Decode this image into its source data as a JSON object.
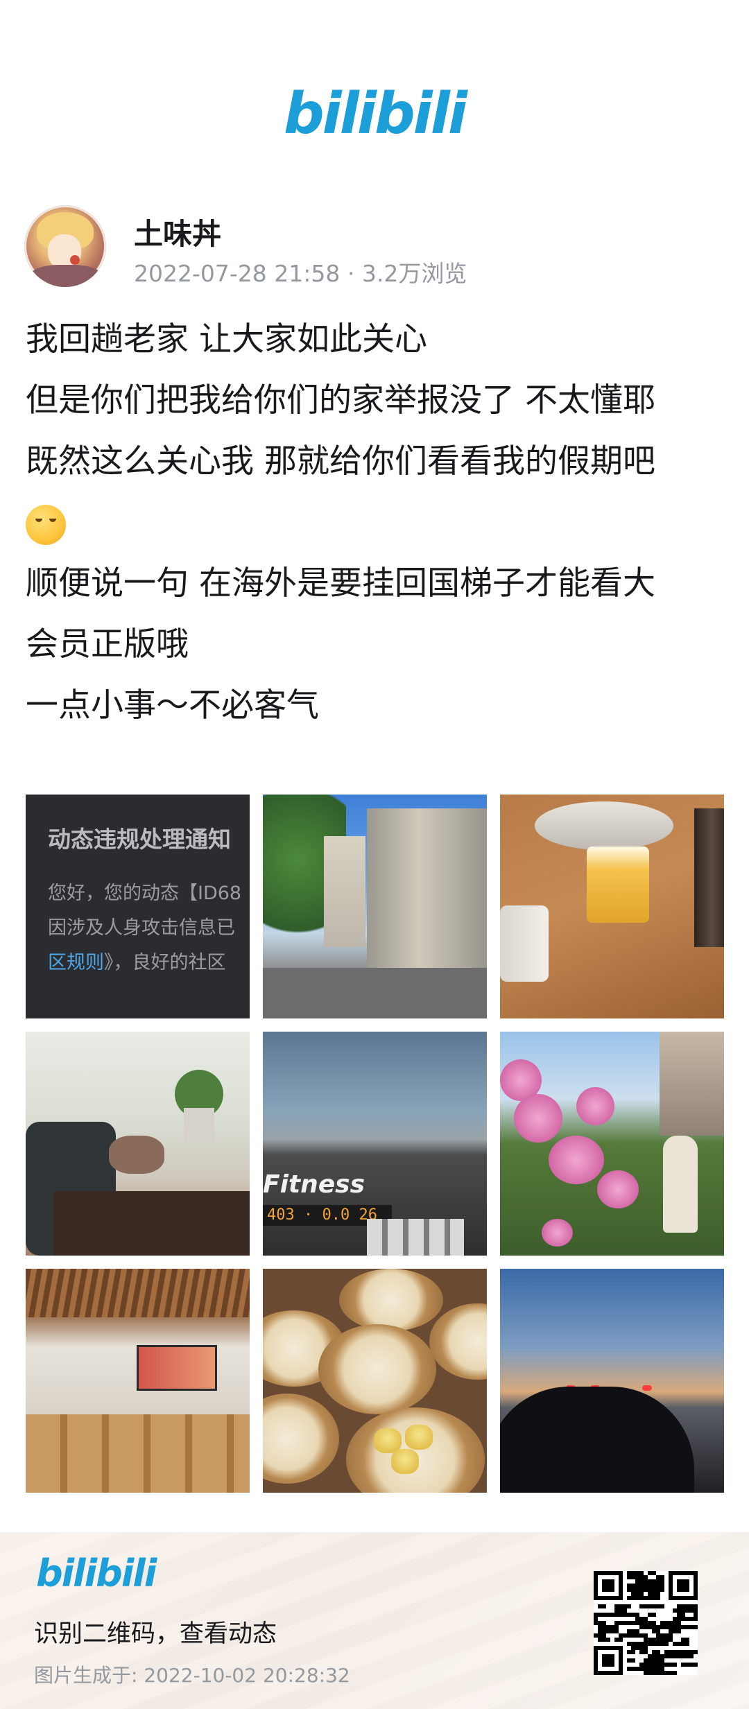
{
  "header": {
    "logo_text": "bilibili"
  },
  "author": {
    "name": "土味丼",
    "date": "2022-07-28 21:58",
    "separator": " · ",
    "views": "3.2万浏览"
  },
  "post": {
    "lines": [
      "我回趟老家 让大家如此关心",
      "但是你们把我给你们的家举报没了 不太懂耶",
      "既然这么关心我 那就给你们看看我的假期吧",
      "",
      "顺便说一句 在海外是要挂回国梯子才能看大",
      "会员正版哦",
      "一点小事～不必客气"
    ]
  },
  "images": {
    "notice": {
      "title": "动态违规处理通知",
      "body1": "您好，您的动态【ID68",
      "body2": "因涉及人身攻击信息已",
      "link": "区规则",
      "body3": "》，良好的社区"
    },
    "gym_brand": "Fitness",
    "gym_display": "403 · 0.0   26"
  },
  "footer": {
    "logo_text": "bilibili",
    "cta": "识别二维码，查看动态",
    "generated": "图片生成于: 2022-10-02 20:28:32"
  }
}
